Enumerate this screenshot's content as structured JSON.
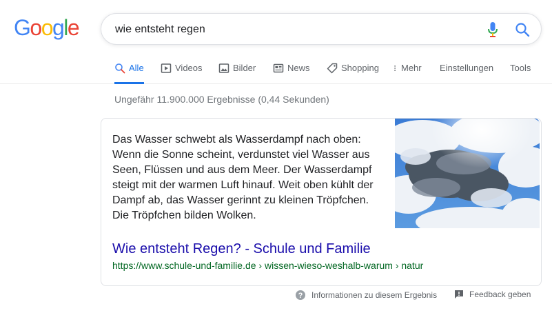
{
  "logo": {
    "letters": [
      "G",
      "o",
      "o",
      "g",
      "l",
      "e"
    ],
    "colors": [
      "#4285F4",
      "#EA4335",
      "#FBBC05",
      "#4285F4",
      "#34A853",
      "#EA4335"
    ]
  },
  "search": {
    "query": "wie entsteht regen"
  },
  "tabs": [
    {
      "label": "Alle",
      "icon": "search-icon"
    },
    {
      "label": "Videos",
      "icon": "play-icon"
    },
    {
      "label": "Bilder",
      "icon": "image-icon"
    },
    {
      "label": "News",
      "icon": "newspaper-icon"
    },
    {
      "label": "Shopping",
      "icon": "tag-icon"
    },
    {
      "label": "Mehr",
      "icon": "more-vert-icon"
    },
    {
      "label": "Einstellungen"
    },
    {
      "label": "Tools"
    }
  ],
  "stats": "Ungefähr 11.900.000 Ergebnisse (0,44 Sekunden)",
  "featured_snippet": {
    "text": "Das Wasser schwebt als Wasserdampf nach oben: Wenn die Sonne scheint, verdunstet viel Wasser aus Seen, Flüssen und aus dem Meer. Der Wasserdampf steigt mit der warmen Luft hinauf. Weit oben kühlt der Dampf ab, das Wasser gerinnt zu kleinen Tröpfchen. Die Tröpfchen bilden Wolken.",
    "title": "Wie entsteht Regen? - Schule und Familie",
    "url": "https://www.schule-und-familie.de › wissen-wieso-weshalb-warum › natur"
  },
  "footer": {
    "about": "Informationen zu diesem Ergebnis",
    "feedback": "Feedback geben"
  },
  "colors": {
    "accent": "#1a73e8",
    "link": "#1a0dab",
    "url": "#006621"
  }
}
